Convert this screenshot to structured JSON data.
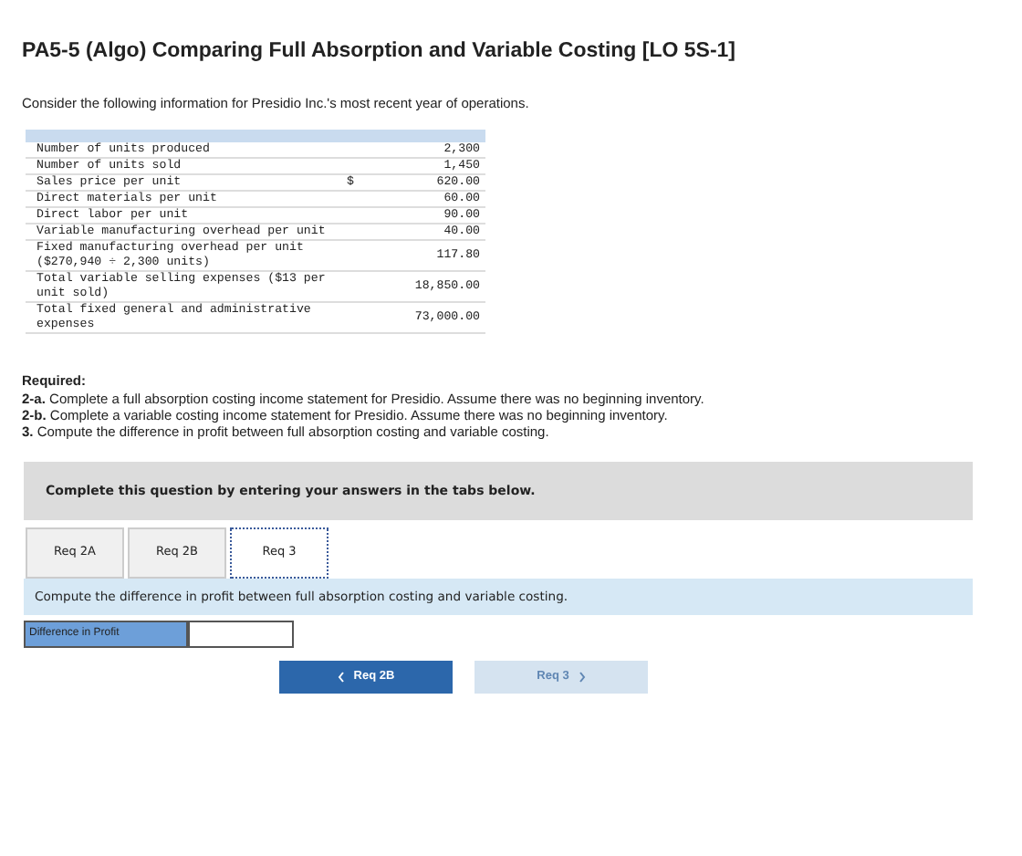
{
  "title": "PA5-5 (Algo) Comparing Full Absorption and Variable Costing [LO 5S-1]",
  "intro": "Consider the following information for Presidio Inc.'s most recent year of operations.",
  "facts": [
    {
      "label": "Number of units produced",
      "value": "2,300"
    },
    {
      "label": "Number of units sold",
      "value": "1,450"
    },
    {
      "label": "Sales price per unit",
      "currency": "$",
      "value": "620.00"
    },
    {
      "label": "Direct materials per unit",
      "value": "60.00"
    },
    {
      "label": "Direct labor per unit",
      "value": "90.00"
    },
    {
      "label": "Variable manufacturing overhead per unit",
      "value": "40.00"
    },
    {
      "label": "Fixed manufacturing overhead per unit ($270,940 ÷ 2,300 units)",
      "value": "117.80"
    },
    {
      "label": "Total variable selling expenses ($13 per unit sold)",
      "value": "18,850.00"
    },
    {
      "label": "Total fixed general and administrative expenses",
      "value": "73,000.00"
    }
  ],
  "required_heading": "Required:",
  "requirements": [
    "**2-a.** Complete a full absorption costing income statement for Presidio. Assume there was no beginning inventory.",
    "**2-b.** Complete a variable costing income statement for Presidio. Assume there was no beginning inventory.",
    "**3.** Compute the difference in profit between full absorption costing and variable costing."
  ],
  "notice": "Complete this question by entering your answers in the tabs below.",
  "tabs": [
    {
      "label": "Req 2A",
      "selected": false
    },
    {
      "label": "Req 2B",
      "selected": false
    },
    {
      "label": "Req 3",
      "selected": true
    }
  ],
  "instruction": "Compute the difference in profit between full absorption costing and variable costing.",
  "answer": {
    "label": "Difference in Profit"
  },
  "nav": [
    {
      "label": "Req 2B",
      "kind": "previous",
      "disabled": false
    },
    {
      "label": "Req 3",
      "kind": "next",
      "disabled": true
    }
  ]
}
